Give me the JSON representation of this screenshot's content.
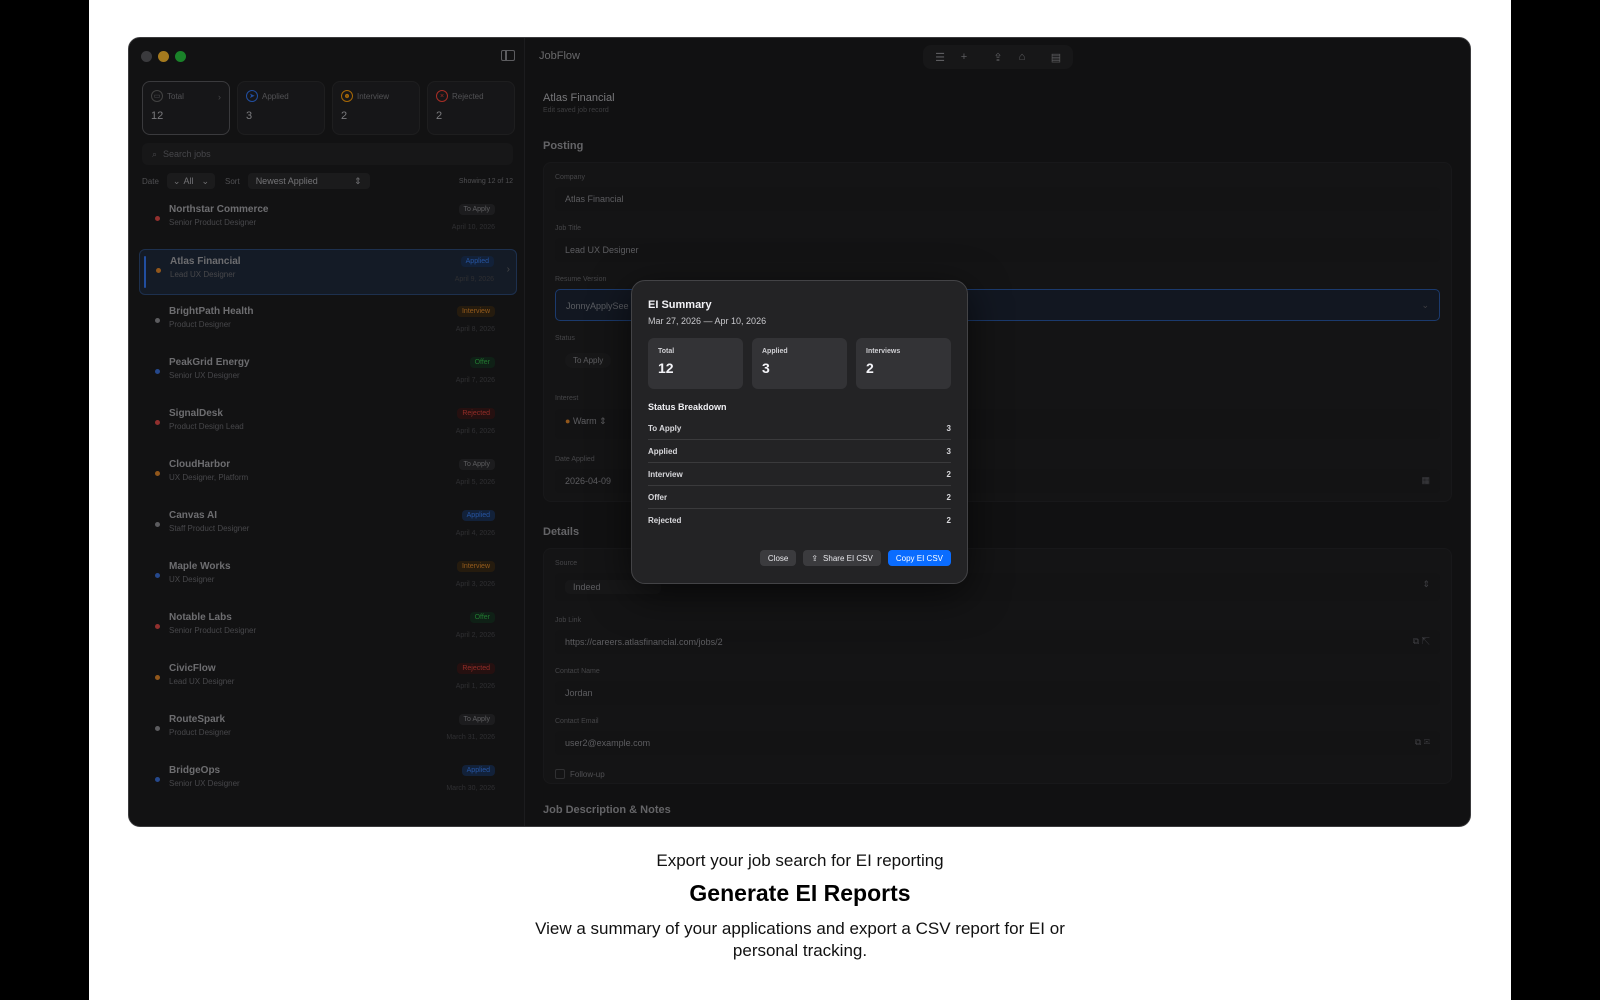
{
  "app": {
    "title": "JobFlow"
  },
  "stats": [
    {
      "label": "Total",
      "value": "12",
      "icon": "tray-icon",
      "icon_glyph": "▭",
      "icon_color": "#8e8e93"
    },
    {
      "label": "Applied",
      "value": "3",
      "icon": "paperplane-icon",
      "icon_glyph": "➤",
      "icon_color": "#3478f6"
    },
    {
      "label": "Interview",
      "value": "2",
      "icon": "people-icon",
      "icon_glyph": "☻",
      "icon_color": "#ff9f0a"
    },
    {
      "label": "Rejected",
      "value": "2",
      "icon": "xmark-circle-icon",
      "icon_glyph": "×",
      "icon_color": "#ff453a"
    }
  ],
  "search": {
    "placeholder": "Search jobs"
  },
  "filters": {
    "date_label": "Date",
    "date_value": "All",
    "sort_label": "Sort",
    "sort_value": "Newest Applied",
    "showing": "Showing 12 of 12"
  },
  "jobs": [
    {
      "company": "Northstar Commerce",
      "role": "Senior Product Designer",
      "status": "To Apply",
      "date": "April 10, 2026",
      "dot": "#e04a48",
      "color": "#8e8e93",
      "bg": "#2c2c2e"
    },
    {
      "company": "Atlas Financial",
      "role": "Lead UX Designer",
      "status": "Applied",
      "date": "April 9, 2026",
      "dot": "#e0862a",
      "color": "#3a82f7",
      "bg": "#1d3358",
      "selected": true
    },
    {
      "company": "BrightPath Health",
      "role": "Product Designer",
      "status": "Interview",
      "date": "April 8, 2026",
      "dot": "#8e8e93",
      "color": "#e08a2a",
      "bg": "#3a2a16"
    },
    {
      "company": "PeakGrid Energy",
      "role": "Senior UX Designer",
      "status": "Offer",
      "date": "April 7, 2026",
      "dot": "#3a6fd8",
      "color": "#35b84a",
      "bg": "#173222"
    },
    {
      "company": "SignalDesk",
      "role": "Product Design Lead",
      "status": "Rejected",
      "date": "April 6, 2026",
      "dot": "#e04a48",
      "color": "#e0443c",
      "bg": "#3a1a1a"
    },
    {
      "company": "CloudHarbor",
      "role": "UX Designer, Platform",
      "status": "To Apply",
      "date": "April 5, 2026",
      "dot": "#e0862a",
      "color": "#8e8e93",
      "bg": "#2c2c2e"
    },
    {
      "company": "Canvas AI",
      "role": "Staff Product Designer",
      "status": "Applied",
      "date": "April 4, 2026",
      "dot": "#8e8e93",
      "color": "#3a82f7",
      "bg": "#1d3358"
    },
    {
      "company": "Maple Works",
      "role": "UX Designer",
      "status": "Interview",
      "date": "April 3, 2026",
      "dot": "#3a6fd8",
      "color": "#e08a2a",
      "bg": "#3a2a16"
    },
    {
      "company": "Notable Labs",
      "role": "Senior Product Designer",
      "status": "Offer",
      "date": "April 2, 2026",
      "dot": "#e04a48",
      "color": "#35b84a",
      "bg": "#173222"
    },
    {
      "company": "CivicFlow",
      "role": "Lead UX Designer",
      "status": "Rejected",
      "date": "April 1, 2026",
      "dot": "#e0862a",
      "color": "#e0443c",
      "bg": "#3a1a1a"
    },
    {
      "company": "RouteSpark",
      "role": "Product Designer",
      "status": "To Apply",
      "date": "March 31, 2026",
      "dot": "#8e8e93",
      "color": "#8e8e93",
      "bg": "#2c2c2e"
    },
    {
      "company": "BridgeOps",
      "role": "Senior UX Designer",
      "status": "Applied",
      "date": "March 30, 2026",
      "dot": "#3a6fd8",
      "color": "#3a82f7",
      "bg": "#1d3358"
    }
  ],
  "record": {
    "title": "Atlas Financial",
    "subtitle": "Edit saved job record",
    "posting_header": "Posting",
    "company_label": "Company",
    "company_value": "Atlas Financial",
    "job_title_label": "Job Title",
    "job_title_value": "Lead UX Designer",
    "resume_label": "Resume Version",
    "resume_value": "JonnyApplySee",
    "status_label": "Status",
    "status_value": "To Apply",
    "interest_label": "Interest",
    "interest_value": "Warm",
    "date_label": "Date Applied",
    "date_value": "2026-04-09",
    "details_header": "Details",
    "source_label": "Source",
    "source_value": "Indeed",
    "link_label": "Job Link",
    "link_value": "https://careers.atlasfinancial.com/jobs/2",
    "contact_name_label": "Contact Name",
    "contact_name_value": "Jordan",
    "contact_email_label": "Contact Email",
    "contact_email_value": "user2@example.com",
    "followup_label": "Follow-up",
    "notes_header": "Job Description & Notes"
  },
  "modal": {
    "title": "EI Summary",
    "range": "Mar 27, 2026 — Apr 10, 2026",
    "cards": [
      {
        "label": "Total",
        "value": "12"
      },
      {
        "label": "Applied",
        "value": "3"
      },
      {
        "label": "Interviews",
        "value": "2"
      }
    ],
    "breakdown_title": "Status Breakdown",
    "breakdown": [
      {
        "label": "To Apply",
        "value": "3"
      },
      {
        "label": "Applied",
        "value": "3"
      },
      {
        "label": "Interview",
        "value": "2"
      },
      {
        "label": "Offer",
        "value": "2"
      },
      {
        "label": "Rejected",
        "value": "2"
      }
    ],
    "close_label": "Close",
    "share_label": "Share EI CSV",
    "copy_label": "Copy EI CSV"
  },
  "caption": {
    "eyebrow": "Export your job search for EI reporting",
    "headline": "Generate EI Reports",
    "body": "View a summary of your applications and export a CSV report for EI or personal tracking."
  }
}
